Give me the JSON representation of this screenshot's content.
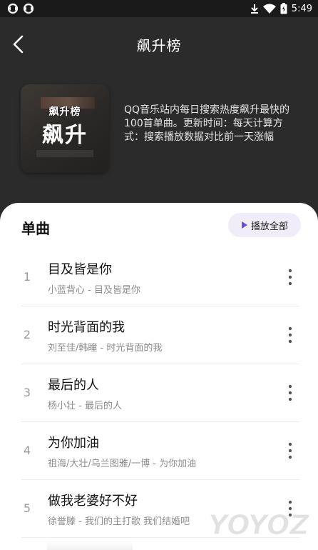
{
  "status_bar": {
    "time": "5:49",
    "left_icons": [
      "sync-icon",
      "sync-icon"
    ],
    "right_icons": [
      "download-icon",
      "wifi-icon",
      "battery-icon"
    ]
  },
  "header": {
    "title": "飙升榜",
    "back_icon": "back-icon"
  },
  "cover": {
    "small_text": "飙升榜",
    "big_text": "飙升"
  },
  "description": "QQ音乐站内每日搜索热度飙升最快的100首单曲。更新时间：每天计算方式：搜索播放数据对比前一天涨幅",
  "section": {
    "title": "单曲",
    "play_all_label": "播放全部"
  },
  "songs": [
    {
      "index": "1",
      "title": "目及皆是你",
      "subtitle": "小蓝背心 - 目及皆是你"
    },
    {
      "index": "2",
      "title": "时光背面的我",
      "subtitle": "刘至佳/韩瞳 - 时光背面的我"
    },
    {
      "index": "3",
      "title": "最后的人",
      "subtitle": "杨小壮 - 最后的人"
    },
    {
      "index": "4",
      "title": "为你加油",
      "subtitle": "祖海/大壮/乌兰图雅/一博 - 为你加油"
    },
    {
      "index": "5",
      "title": "做我老婆好不好",
      "subtitle": "徐誉滕 - 我们的主打歌 我们结婚吧"
    }
  ],
  "watermark": "YOYOZ",
  "colors": {
    "background": "#2b2b2b",
    "sheet": "#ffffff",
    "accent": "#6c4bd8",
    "play_all_bg": "#f0edf8"
  }
}
